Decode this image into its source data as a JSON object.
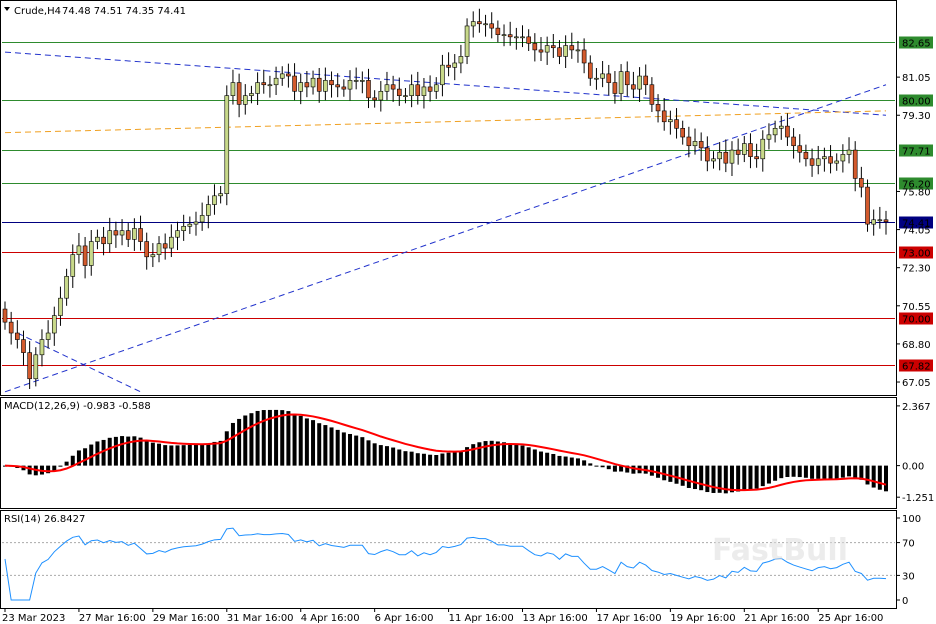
{
  "header": {
    "symbol_label": "Crude,H4",
    "ohlc": "74.48 74.51 74.35 74.41"
  },
  "colors": {
    "bull_body": "#c8d98a",
    "bear_body": "#d35a2d",
    "wick": "#000000",
    "grid_level": "#2e8b2e",
    "resistance_red": "#cc0000",
    "price_line": "#000080",
    "trend_blue": "#2233cc",
    "trend_orange": "#f0a020",
    "macd_hist": "#000000",
    "macd_signal": "#ff0000",
    "rsi_line": "#1e90ff"
  },
  "chart_data": [
    {
      "type": "candlestick",
      "title": "Crude,H4",
      "ylim": [
        66.5,
        84.5
      ],
      "y_ticks": [
        "81.05",
        "79.30",
        "75.80",
        "74.05",
        "72.30",
        "70.55",
        "68.80",
        "67.05"
      ],
      "levels": [
        {
          "value": 82.65,
          "label": "82.65",
          "color": "#2e8b2e"
        },
        {
          "value": 80.0,
          "label": "80.00",
          "color": "#2e8b2e"
        },
        {
          "value": 77.71,
          "label": "77.71",
          "color": "#2e8b2e"
        },
        {
          "value": 76.2,
          "label": "76.20",
          "color": "#2e8b2e"
        },
        {
          "value": 74.41,
          "label": "74.41",
          "color": "#000080"
        },
        {
          "value": 73.0,
          "label": "73.00",
          "color": "#cc0000"
        },
        {
          "value": 70.0,
          "label": "70.00",
          "color": "#cc0000"
        },
        {
          "value": 67.82,
          "label": "67.82",
          "color": "#cc0000"
        }
      ],
      "trendlines": [
        {
          "from": [
            0,
            82.2
          ],
          "to": [
            143,
            79.3
          ],
          "color": "#2233cc",
          "dash": true
        },
        {
          "from": [
            0,
            66.6
          ],
          "to": [
            143,
            80.7
          ],
          "color": "#2233cc",
          "dash": true
        },
        {
          "from": [
            0,
            78.5
          ],
          "to": [
            143,
            79.5
          ],
          "color": "#f0a020",
          "dash": true
        },
        {
          "from": [
            2,
            69.3
          ],
          "to": [
            22,
            66.6
          ],
          "color": "#2233cc",
          "dash": true
        }
      ],
      "x_ticks": [
        {
          "i": 0,
          "label": "23 Mar 2023"
        },
        {
          "i": 12,
          "label": "27 Mar 16:00"
        },
        {
          "i": 24,
          "label": "29 Mar 16:00"
        },
        {
          "i": 36,
          "label": "31 Mar 16:00"
        },
        {
          "i": 48,
          "label": "4 Apr 16:00"
        },
        {
          "i": 60,
          "label": "6 Apr 16:00"
        },
        {
          "i": 72,
          "label": "11 Apr 16:00"
        },
        {
          "i": 84,
          "label": "13 Apr 16:00"
        },
        {
          "i": 96,
          "label": "17 Apr 16:00"
        },
        {
          "i": 108,
          "label": "19 Apr 16:00"
        },
        {
          "i": 120,
          "label": "21 Apr 16:00"
        },
        {
          "i": 132,
          "label": "25 Apr 16:00"
        }
      ],
      "closes": [
        69.8,
        69.3,
        69.0,
        68.4,
        67.2,
        68.3,
        69.0,
        69.3,
        70.1,
        70.9,
        71.9,
        72.9,
        73.3,
        72.4,
        73.5,
        73.7,
        73.4,
        74.0,
        73.8,
        74.0,
        73.6,
        74.1,
        73.5,
        72.8,
        72.9,
        73.4,
        73.2,
        73.7,
        74.0,
        74.2,
        74.3,
        74.4,
        74.7,
        75.2,
        75.6,
        75.7,
        80.2,
        80.8,
        79.8,
        80.2,
        80.3,
        80.8,
        80.7,
        80.7,
        81.0,
        81.2,
        81.1,
        80.4,
        80.8,
        80.6,
        81.0,
        80.4,
        80.9,
        80.7,
        80.6,
        80.5,
        80.9,
        80.9,
        80.9,
        80.1,
        80.0,
        80.4,
        80.7,
        80.5,
        80.2,
        80.2,
        80.7,
        80.2,
        80.6,
        80.4,
        80.7,
        81.6,
        81.5,
        81.7,
        82.0,
        83.4,
        83.6,
        83.5,
        83.5,
        83.3,
        83.0,
        83.0,
        82.9,
        82.9,
        82.9,
        82.6,
        82.3,
        82.2,
        82.5,
        82.4,
        82.0,
        82.5,
        82.3,
        82.3,
        81.7,
        81.0,
        81.0,
        81.2,
        80.8,
        80.3,
        81.3,
        80.7,
        80.5,
        81.1,
        80.7,
        79.8,
        79.5,
        79.0,
        79.1,
        78.7,
        78.3,
        77.9,
        78.1,
        77.8,
        77.2,
        77.3,
        77.6,
        77.1,
        77.7,
        77.5,
        78.0,
        77.4,
        77.3,
        78.2,
        78.4,
        78.7,
        78.8,
        78.3,
        77.9,
        77.6,
        77.3,
        77.0,
        77.3,
        77.4,
        77.1,
        77.2,
        77.5,
        77.7,
        76.4,
        76.0,
        74.3,
        74.5,
        74.5,
        74.41
      ],
      "candle_count": 144
    },
    {
      "type": "bar+line",
      "title": "MACD(12,26,9) -0.983 -0.588",
      "y_ticks": [
        "2.367",
        "0.00",
        "-1.251"
      ],
      "ylim": [
        -1.6,
        2.6
      ],
      "series": [
        {
          "name": "histogram",
          "style": "bar"
        },
        {
          "name": "signal",
          "style": "line"
        }
      ]
    },
    {
      "type": "line",
      "title": "RSI(14) 26.8427",
      "ylim": [
        0,
        100
      ],
      "y_ticks": [
        "100",
        "70",
        "30",
        "0"
      ],
      "levels": [
        70,
        30
      ]
    }
  ],
  "watermark": "FastBull"
}
